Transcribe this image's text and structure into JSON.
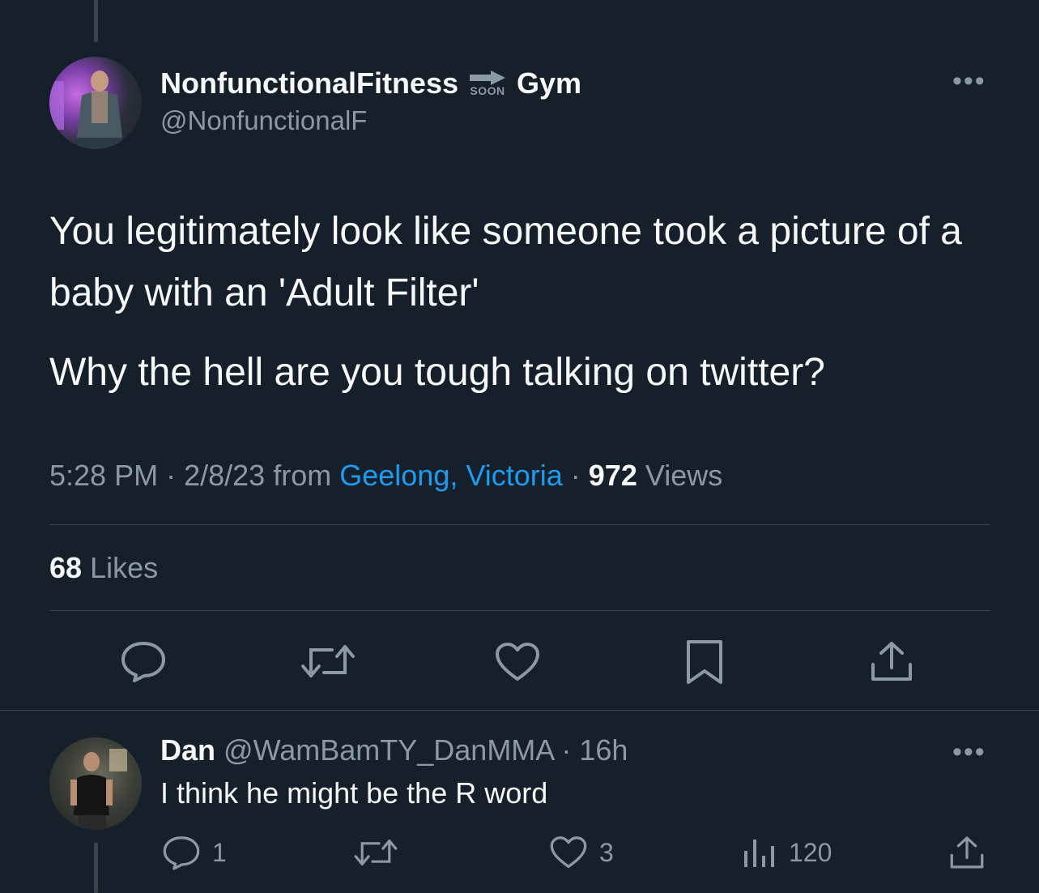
{
  "tweet": {
    "author_name": "NonfunctionalFitness",
    "badge_text": "SOON",
    "author_name_suffix": "Gym",
    "handle": "@NonfunctionalF",
    "body_lines": [
      "You legitimately look like someone took a picture of a baby with an 'Adult Filter'",
      "Why the hell are you tough talking on twitter?"
    ],
    "time": "5:28 PM",
    "date": "2/8/23",
    "from_label": "from",
    "location": "Geelong, Victoria",
    "views_count": "972",
    "views_label": "Views",
    "likes_count": "68",
    "likes_label": "Likes",
    "separator": "·"
  },
  "reply": {
    "name": "Dan",
    "handle": "@WamBamTY_DanMMA",
    "age": "16h",
    "separator": "·",
    "text": "I think he might be the R word",
    "reply_count": "1",
    "like_count": "3",
    "view_count": "120"
  },
  "colors": {
    "background": "#15202b",
    "text": "#f7f9f9",
    "secondary": "#8b98a5",
    "link": "#1d9bf0",
    "border": "#38444d"
  }
}
